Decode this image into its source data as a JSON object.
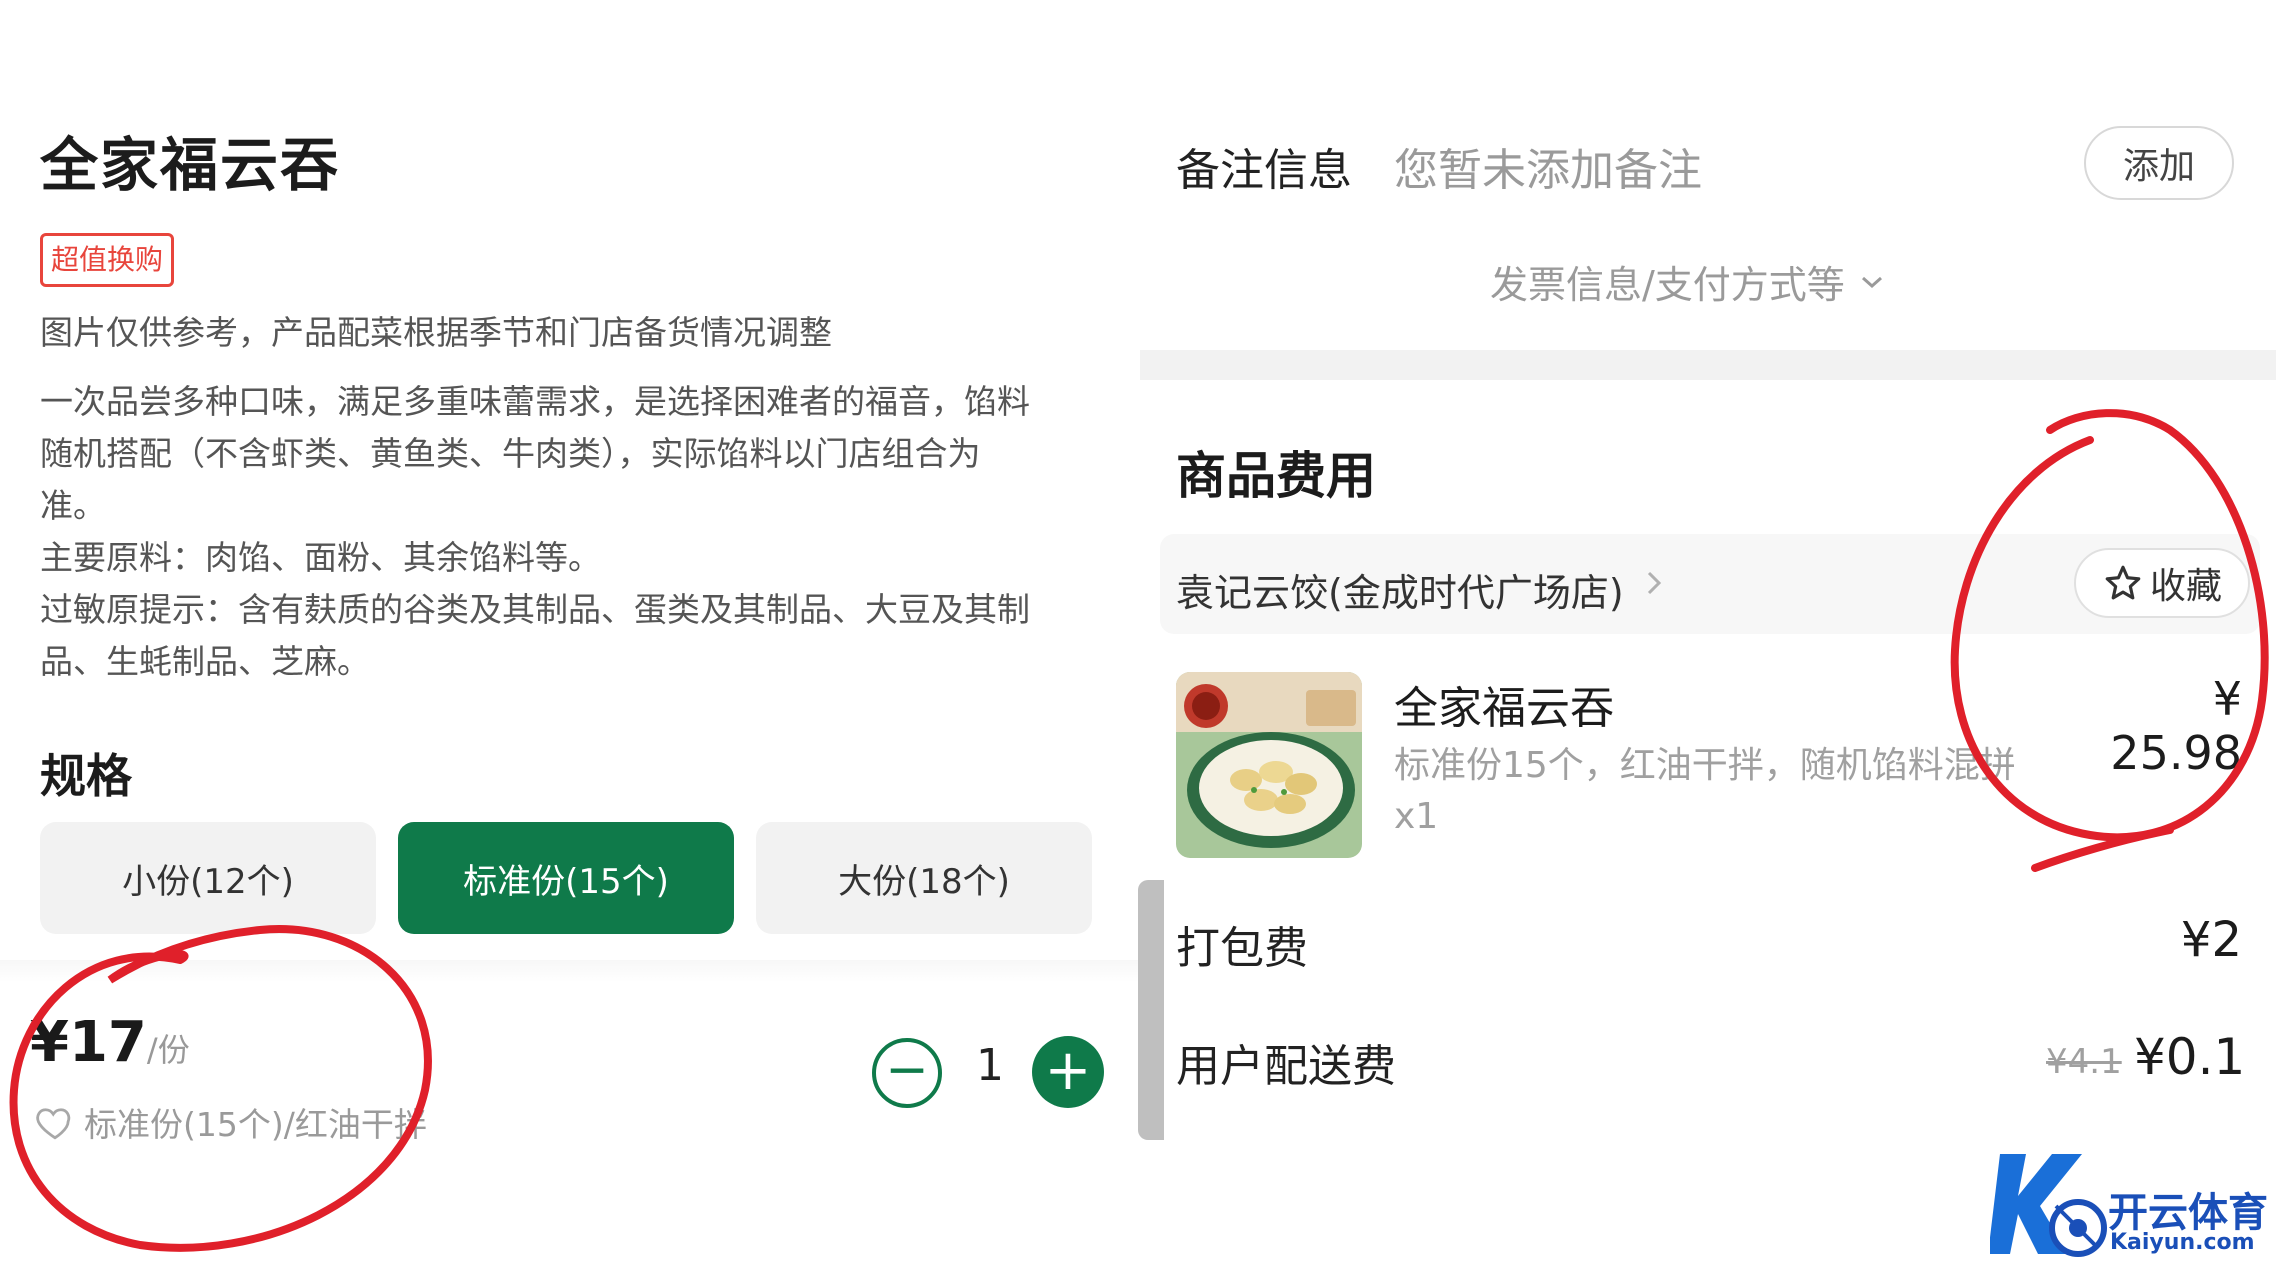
{
  "left": {
    "product_title": "全家福云吞",
    "promo_tag": "超值换购",
    "note": "图片仅供参考，产品配菜根据季节和门店备货情况调整",
    "description_lines": [
      "一次品尝多种口味，满足多重味蕾需求，是选择困难者的福音，馅料",
      "随机搭配（不含虾类、黄鱼类、牛肉类），实际馅料以门店组合为",
      "准。",
      "主要原料：肉馅、面粉、其余馅料等。",
      "过敏原提示：含有麸质的谷类及其制品、蛋类及其制品、大豆及其制",
      "品、生蚝制品、芝麻。"
    ],
    "spec_title": "规格",
    "specs": [
      {
        "label": "小份(12个)",
        "selected": false
      },
      {
        "label": "标准份(15个)",
        "selected": true
      },
      {
        "label": "大份(18个)",
        "selected": false
      }
    ],
    "price": "¥17",
    "price_unit": "/份",
    "selected_spec": "标准份(15个)/红油干拌",
    "quantity": "1",
    "minus_symbol": "−",
    "plus_symbol": "+"
  },
  "right": {
    "remark_label": "备注信息",
    "remark_value": "您暂未添加备注",
    "add_button": "添加",
    "invoice_link": "发票信息/支付方式等",
    "fee_title": "商品费用",
    "shop_name": "袁记云饺(金成时代广场店)",
    "favorite_button": "收藏",
    "item": {
      "name": "全家福云吞",
      "price": "¥ 25.98",
      "spec": "标准份15个，红油干拌，随机馅料混拼",
      "qty": "x1"
    },
    "packing_label": "打包费",
    "packing_value": "¥2",
    "delivery_label": "用户配送费",
    "delivery_original": "¥4.1",
    "delivery_value": "¥0.1"
  },
  "watermark": {
    "brand": "开云体育",
    "domain": "Kaiyun.com"
  },
  "colors": {
    "brand_green": "#0f7a4a",
    "promo_red": "#e8453c",
    "annotation_red": "#e0202a",
    "watermark_blue": "#1a4fb8"
  },
  "icons": [
    "heart-icon",
    "star-icon",
    "chevron-right-icon",
    "chevron-down-icon",
    "minus-icon",
    "plus-icon"
  ]
}
